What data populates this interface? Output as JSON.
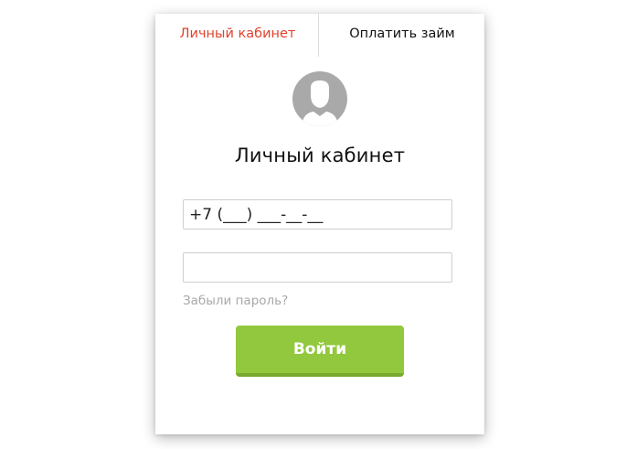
{
  "tabs": {
    "account": "Личный кабинет",
    "pay_loan": "Оплатить займ"
  },
  "form": {
    "title": "Личный кабинет",
    "phone_value": "+7 (___) ___-__-__",
    "password_value": "",
    "forgot_password": "Забыли пароль?",
    "submit_label": "Войти"
  },
  "colors": {
    "active_tab": "#e2412b",
    "button": "#92c83e",
    "avatar": "#a9a9a9"
  },
  "icons": {
    "avatar": "user-avatar-icon"
  }
}
